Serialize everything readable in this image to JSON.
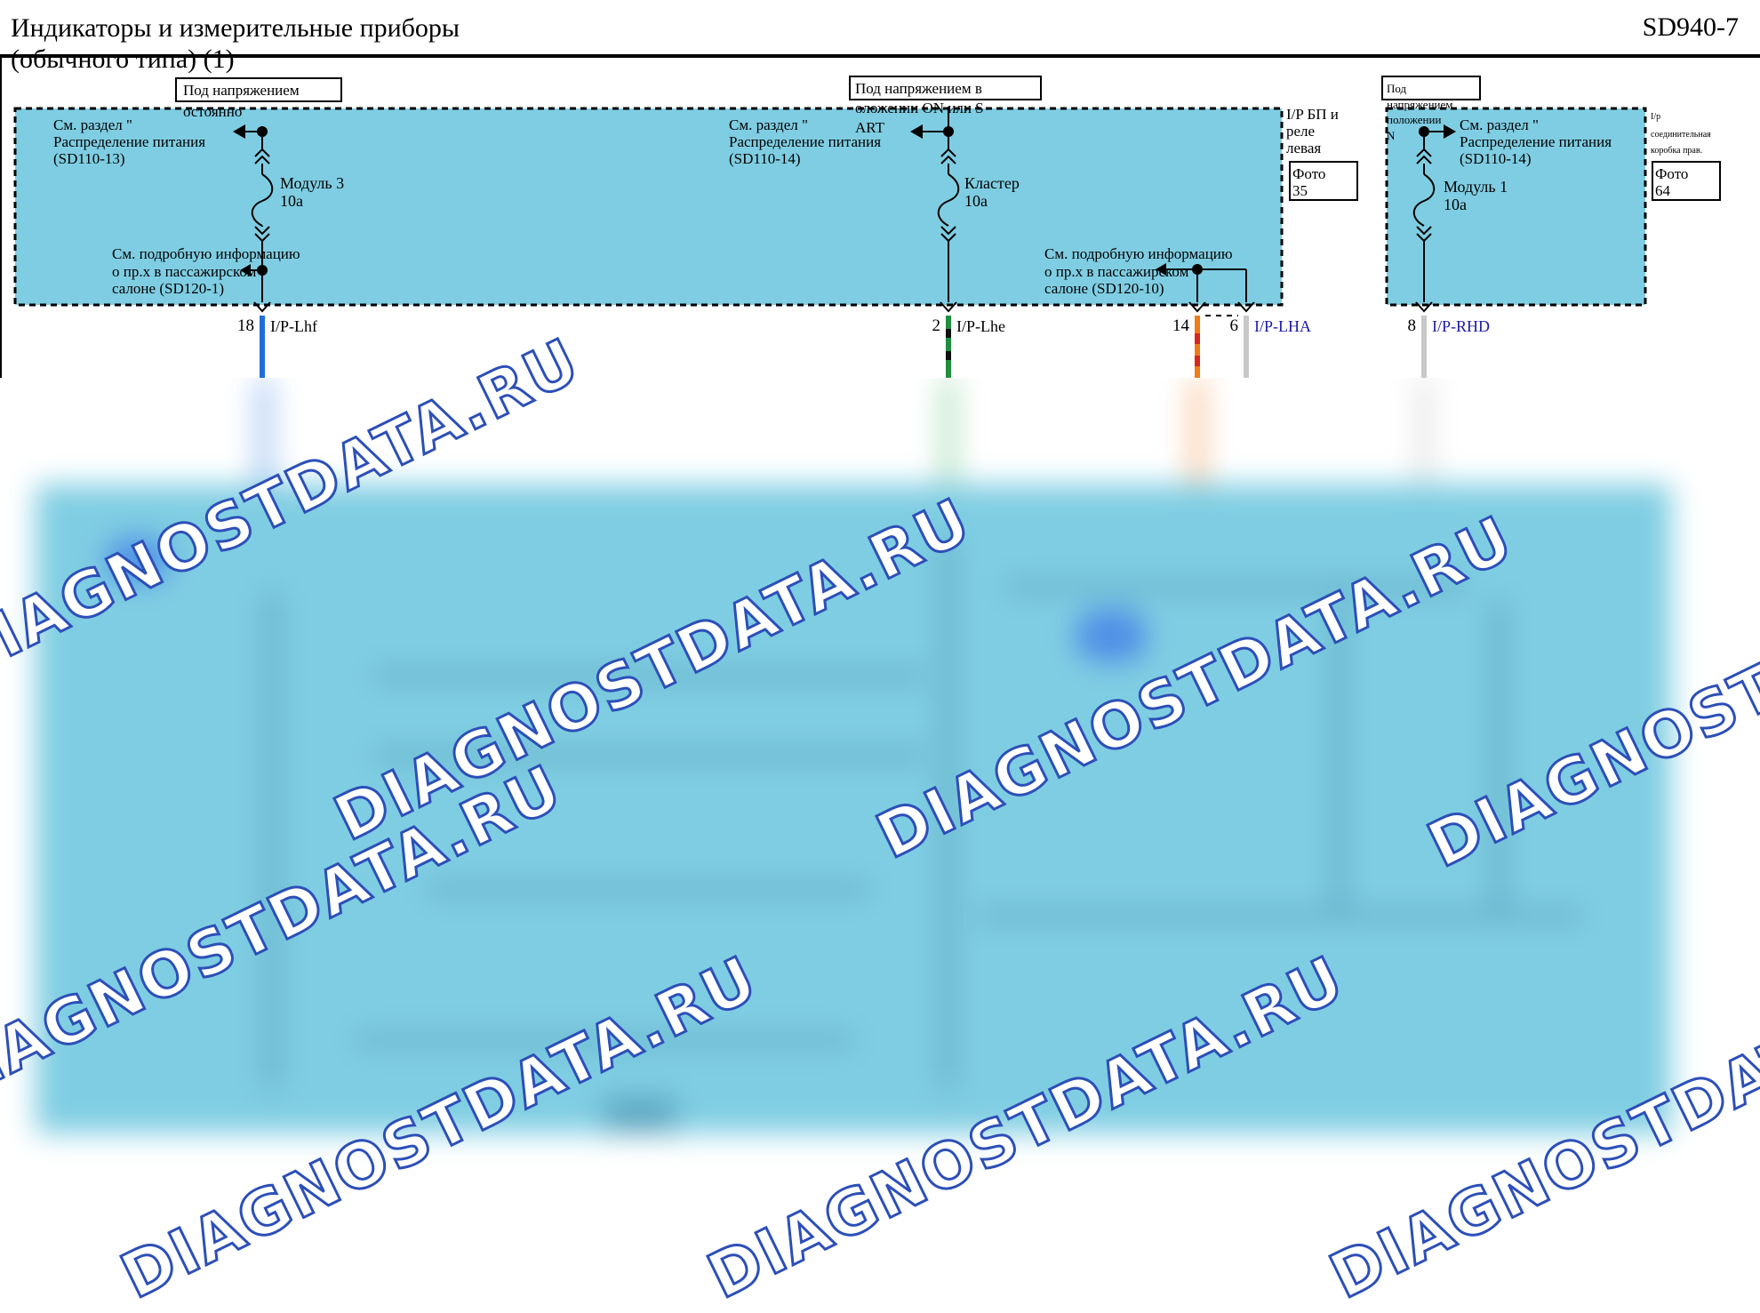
{
  "header": {
    "title_line1": "Индикаторы и измерительные приборы",
    "title_line2": "(обычного типа) (1)",
    "code": "SD940-7"
  },
  "colors": {
    "panel": "#7fcde2",
    "wire_blue": "#1f6fd6",
    "wire_green": "#1f8f3f",
    "wire_orange": "#f07a18",
    "wire_red": "#d8261c",
    "wire_gray": "#c8c8c8",
    "connector_text": "#1a1aa8",
    "watermark": "#2c4fb8"
  },
  "power_labels": {
    "always": "Под напряжением постоянно",
    "on_start": "Под напряжением в положении ON или START",
    "on": "Под напряжением в положении ON"
  },
  "box_left": {
    "title_l1": "I/P БП и",
    "title_l2": "реле",
    "title_l3": "левая",
    "photo_l1": "Фото",
    "photo_l2": "35"
  },
  "box_right": {
    "title_l1": "I/p",
    "title_l2": "соединительная",
    "title_l3": "коробка прав.",
    "photo_l1": "Фото",
    "photo_l2": "64"
  },
  "refs": {
    "pd1_l1": "См. раздел \"",
    "pd1_l2": "Распределение питания",
    "pd1_l3": "(SD110-13)",
    "pd2_l1": "См. раздел \"",
    "pd2_l2": "Распределение питания",
    "pd2_l3": "(SD110-14)",
    "pd3_l1": "См. раздел \"",
    "pd3_l2": "Распределение питания",
    "pd3_l3": "(SD110-14)",
    "det1_l1": "См. подробную информацию",
    "det1_l2": "о пр.х в пассажирском",
    "det1_l3": "салоне (SD120-1)",
    "det2_l1": "См. подробную информацию",
    "det2_l2": "о пр.х в пассажирском",
    "det2_l3": "салоне (SD120-10)"
  },
  "fuses": {
    "f1_name": "Модуль 3",
    "f1_rating": "10а",
    "f2_name": "Кластер",
    "f2_rating": "10а",
    "f3_name": "Модуль 1",
    "f3_rating": "10а"
  },
  "connectors": [
    {
      "pin": "18",
      "name": "I/P-Lhf"
    },
    {
      "pin": "2",
      "name": "I/P-Lhe"
    },
    {
      "pin": "14",
      "name": ""
    },
    {
      "pin": "6",
      "name": "I/P-LHA"
    },
    {
      "pin": "8",
      "name": "I/P-RHD"
    }
  ],
  "watermark": "DIAGNOSTDATA.RU"
}
